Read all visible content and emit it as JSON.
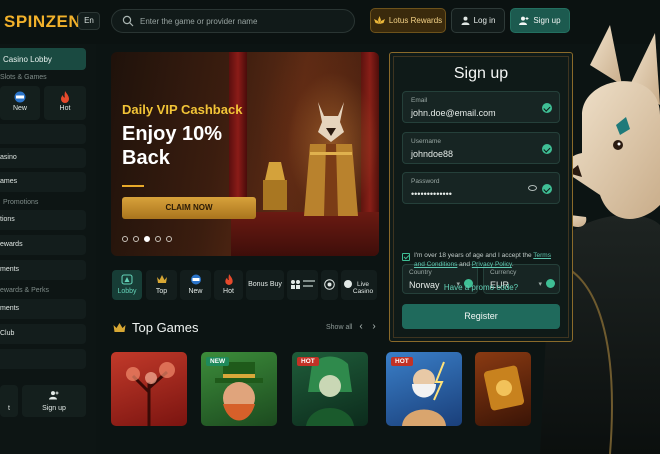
{
  "header": {
    "logo": "SPINZEN",
    "language": "En",
    "search_placeholder": "Enter the game or provider name",
    "lotus_rewards": "Lotus Rewards",
    "login": "Log in",
    "signup": "Sign up"
  },
  "sidebar": {
    "lobby": "Casino Lobby",
    "section_slots": "Slots & Games",
    "tile_new": "New",
    "tile_hot": "Hot",
    "item_casino": "asino",
    "item_games": "ames",
    "section_promotions": "Promotions",
    "item_promotions": "tions",
    "item_rewards": "ewards",
    "item_tournaments": "ments",
    "section_rewards_perks": "ewards & Perks",
    "item_tournaments2": "ments",
    "item_club": "Club",
    "bottom_left": "t",
    "bottom_signup": "Sign up"
  },
  "hero": {
    "subtitle": "Daily VIP Cashback",
    "title": "Enjoy 10% Back",
    "cta": "CLAIM NOW",
    "active_slide": 3,
    "slide_count": 5
  },
  "categories": [
    {
      "label": "Lobby",
      "icon": "lobby-icon",
      "active": true
    },
    {
      "label": "Top",
      "icon": "crown-icon",
      "active": false
    },
    {
      "label": "New",
      "icon": "new-icon",
      "active": false
    },
    {
      "label": "Hot",
      "icon": "fire-icon",
      "active": false
    },
    {
      "label": "Bonus Buy",
      "icon": "",
      "active": false
    },
    {
      "label": "",
      "icon": "table-games-icon",
      "active": false
    },
    {
      "label": "",
      "icon": "roulette-icon",
      "active": false
    },
    {
      "label": "Live Casino",
      "icon": "live-icon",
      "active": false
    }
  ],
  "top_games": {
    "title": "Top Games",
    "show_all": "Show all",
    "prev": "‹",
    "next": "›",
    "games": [
      {
        "badge": ""
      },
      {
        "badge": "NEW"
      },
      {
        "badge": "HOT"
      },
      {
        "badge": "HOT"
      },
      {
        "badge": ""
      }
    ]
  },
  "signup_modal": {
    "title": "Sign up",
    "email_label": "Email",
    "email_value": "john.doe@email.com",
    "username_label": "Username",
    "username_value": "johndoe88",
    "password_label": "Password",
    "password_value": "•••••••••••••",
    "country_label": "Country",
    "country_value": "Norway",
    "currency_label": "Currency",
    "currency_value": "EUR",
    "terms_prefix": "I'm over 18 years of age and I accept the ",
    "terms_link": "Terms and Conditions",
    "terms_and": " and ",
    "privacy_link": "Privacy Policy",
    "terms_suffix": ".",
    "promo": "Have a promo code?",
    "register": "Register"
  },
  "colors": {
    "accent_gold": "#f2b12b",
    "accent_teal": "#1f6a5c",
    "success": "#3fbf95"
  }
}
